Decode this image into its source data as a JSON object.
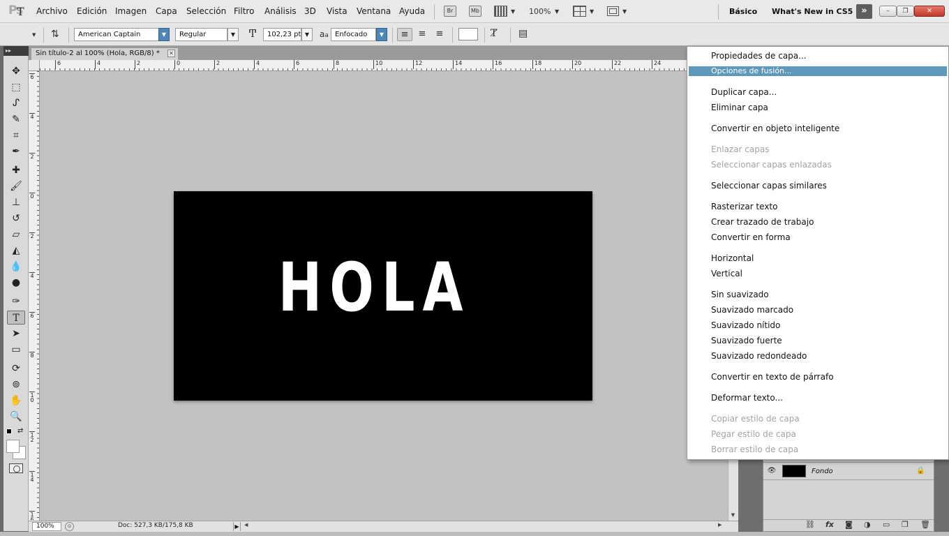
{
  "app": {
    "logo": "Ps",
    "menu": [
      "Archivo",
      "Edición",
      "Imagen",
      "Capa",
      "Selección",
      "Filtro",
      "Análisis",
      "3D",
      "Vista",
      "Ventana",
      "Ayuda"
    ],
    "bridge_btn": "Br",
    "minibridge_btn": "Mb",
    "zoom_level": "100%",
    "workspaces": [
      "Básico",
      "What's New in CS5"
    ],
    "more_glyph": "»",
    "window_controls": [
      "–",
      "❐",
      "✕"
    ]
  },
  "options": {
    "tool_glyph": "T",
    "font_family": "American Captain",
    "font_style": "Regular",
    "font_size": "102,23 pt",
    "antialias_prefix": "a",
    "antialias": "Enfocado",
    "text_color": "#ffffff"
  },
  "document": {
    "tab_title": "Sin título-2 al 100% (Hola, RGB/8) *",
    "close_glyph": "✕",
    "text": "HOLA",
    "background_color": "#000000",
    "ruler_h": [
      "6",
      "4",
      "2",
      "0",
      "2",
      "4",
      "6",
      "8",
      "10",
      "12",
      "14",
      "16",
      "18",
      "20",
      "22",
      "24"
    ],
    "ruler_v": [
      "6",
      "4",
      "2",
      "0",
      "2",
      "4",
      "6",
      "8",
      "10",
      "12",
      "14",
      "16"
    ],
    "zoom": "100%",
    "doc_info": "Doc: 527,3 KB/175,8 KB"
  },
  "layers": {
    "background_layer_name": "Fondo",
    "footer_icons": [
      "link-icon",
      "fx-icon",
      "mask-icon",
      "adjustment-icon",
      "group-icon",
      "new-layer-icon",
      "trash-icon"
    ]
  },
  "context_menu": {
    "highlight_color": "#5e99bb",
    "items": [
      {
        "label": "Propiedades de capa...",
        "enabled": true,
        "selected": false
      },
      {
        "label": "Opciones de fusión...",
        "enabled": true,
        "selected": true
      },
      {
        "label": "Duplicar capa...",
        "enabled": true,
        "selected": false
      },
      {
        "label": "Eliminar capa",
        "enabled": true,
        "selected": false
      },
      {
        "label": "Convertir en objeto inteligente",
        "enabled": true,
        "selected": false
      },
      {
        "label": "Enlazar capas",
        "enabled": false,
        "selected": false
      },
      {
        "label": "Seleccionar capas enlazadas",
        "enabled": false,
        "selected": false
      },
      {
        "label": "Seleccionar capas similares",
        "enabled": true,
        "selected": false
      },
      {
        "label": "Rasterizar texto",
        "enabled": true,
        "selected": false
      },
      {
        "label": "Crear trazado de trabajo",
        "enabled": true,
        "selected": false
      },
      {
        "label": "Convertir en forma",
        "enabled": true,
        "selected": false
      },
      {
        "label": "Horizontal",
        "enabled": true,
        "selected": false
      },
      {
        "label": "Vertical",
        "enabled": true,
        "selected": false
      },
      {
        "label": "Sin suavizado",
        "enabled": true,
        "selected": false
      },
      {
        "label": "Suavizado marcado",
        "enabled": true,
        "selected": false
      },
      {
        "label": "Suavizado nítido",
        "enabled": true,
        "selected": false
      },
      {
        "label": "Suavizado fuerte",
        "enabled": true,
        "selected": false
      },
      {
        "label": "Suavizado redondeado",
        "enabled": true,
        "selected": false
      },
      {
        "label": "Convertir en texto de párrafo",
        "enabled": true,
        "selected": false
      },
      {
        "label": "Deformar texto...",
        "enabled": true,
        "selected": false
      },
      {
        "label": "Copiar estilo de capa",
        "enabled": false,
        "selected": false
      },
      {
        "label": "Pegar estilo de capa",
        "enabled": false,
        "selected": false
      },
      {
        "label": "Borrar estilo de capa",
        "enabled": false,
        "selected": false
      }
    ]
  }
}
